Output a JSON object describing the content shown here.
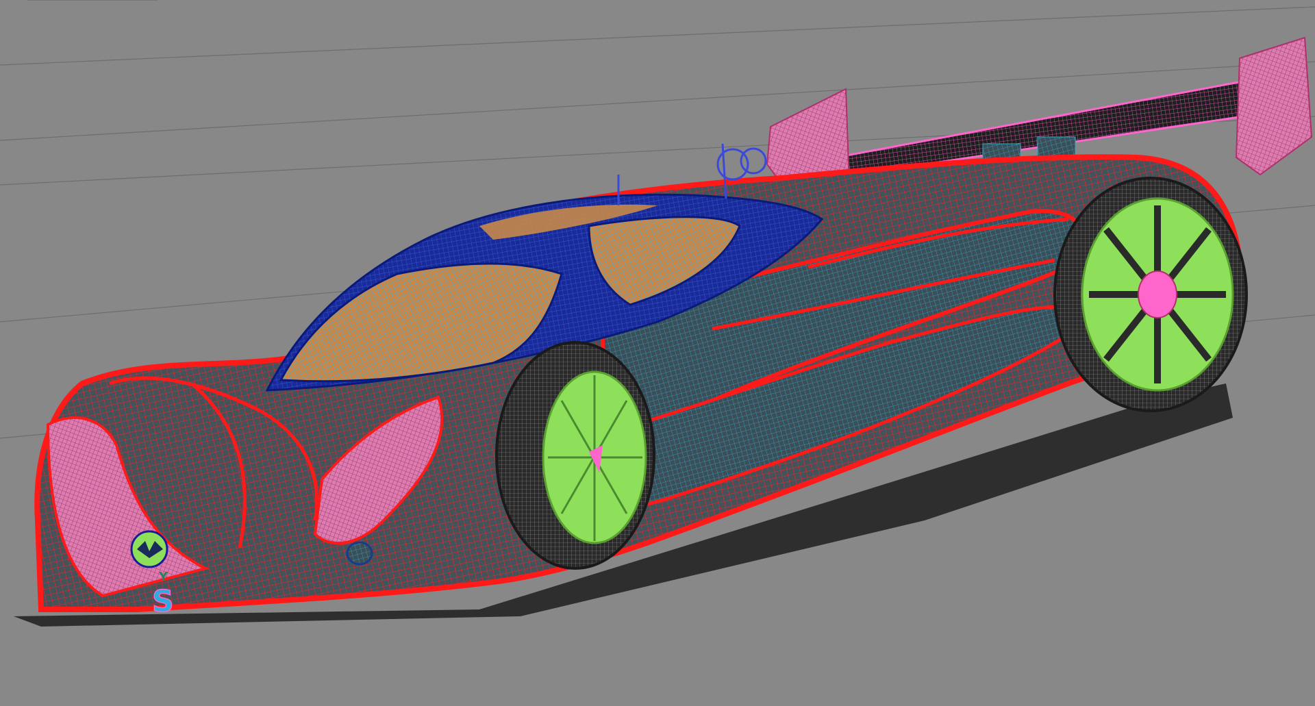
{
  "viewport": {
    "kind": "3d-wireframe-viewport",
    "background_color": "#888888",
    "grid_color": "#6d6d6d"
  },
  "model": {
    "subject": "race-car-wireframe",
    "colors": {
      "body": "#ff1a1a",
      "body_dark": "#3a4a55",
      "accent_pink": "#ff7ac8",
      "cockpit_blue": "#1a2a9a",
      "glass_orange": "#c8884a",
      "glass_cyan": "#3aaee0",
      "rim_green": "#8ee05a",
      "hub_pink": "#ff66cc",
      "tire": "#3a3a3a",
      "wing": "#2a1a2a"
    },
    "badge_letters": [
      "Y",
      "S"
    ]
  }
}
